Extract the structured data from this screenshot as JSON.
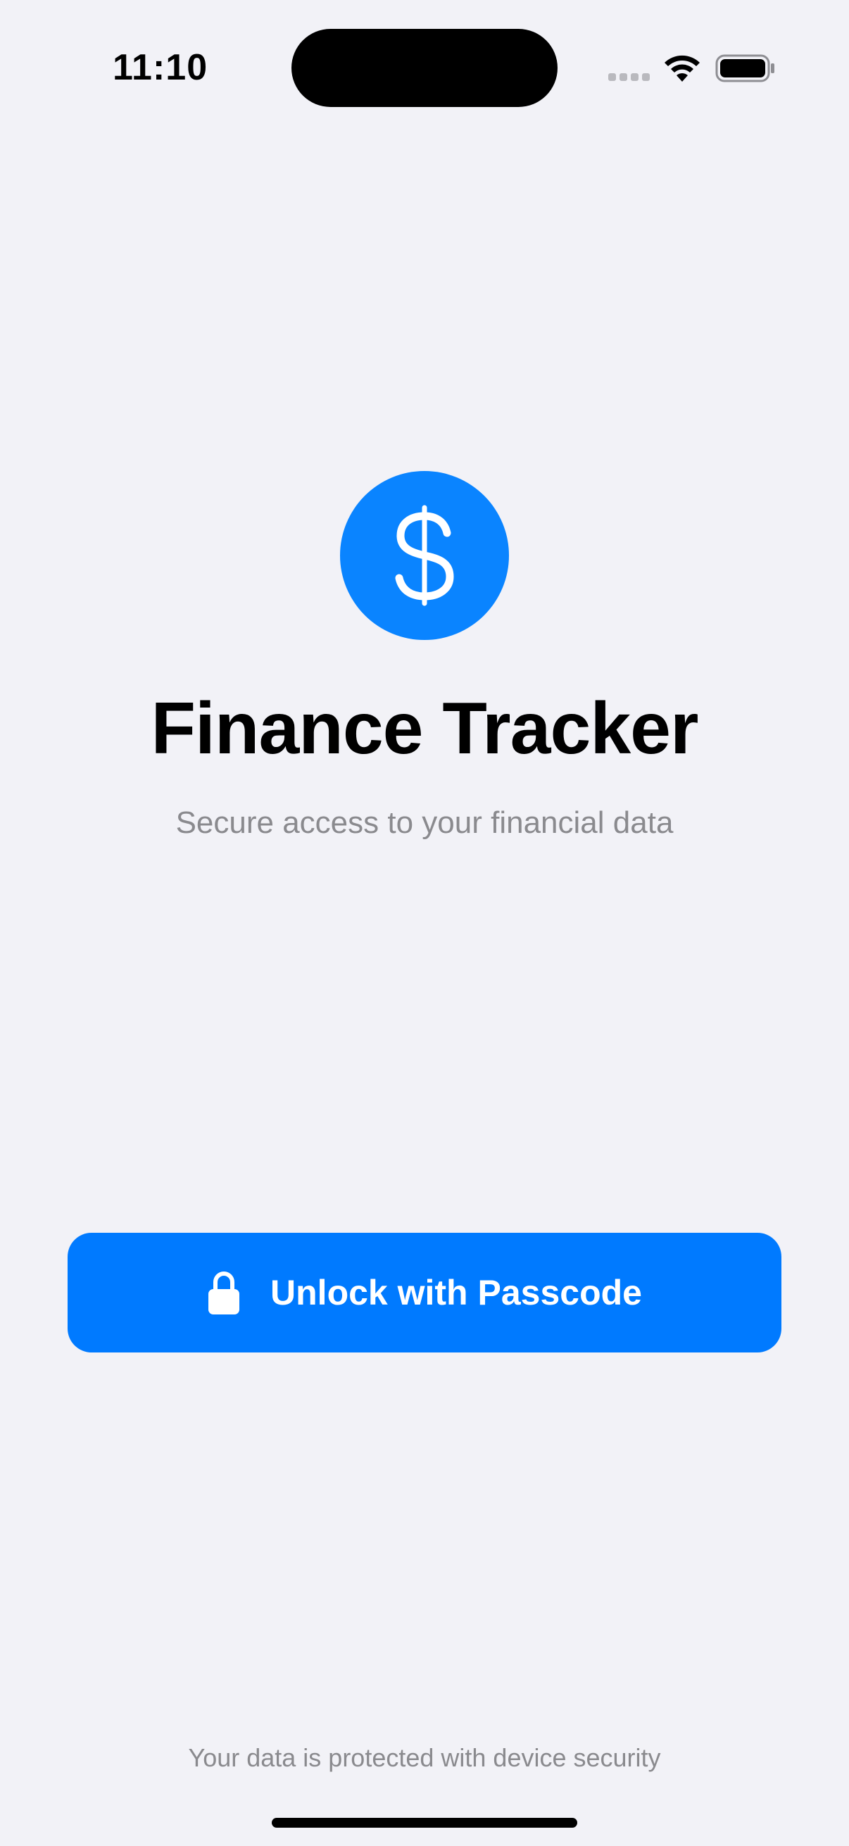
{
  "status_bar": {
    "time": "11:10",
    "icons": [
      "cellular-signal-icon",
      "wifi-icon",
      "battery-icon"
    ]
  },
  "app": {
    "icon": "dollar-sign-icon",
    "title": "Finance Tracker",
    "subtitle": "Secure access to your financial data"
  },
  "unlock": {
    "icon": "lock-icon",
    "label": "Unlock with Passcode"
  },
  "footer": {
    "note": "Your data is protected with device security"
  },
  "colors": {
    "background": "#F2F2F7",
    "accent": "#007AFF",
    "secondary_text": "#8A8A8E"
  }
}
